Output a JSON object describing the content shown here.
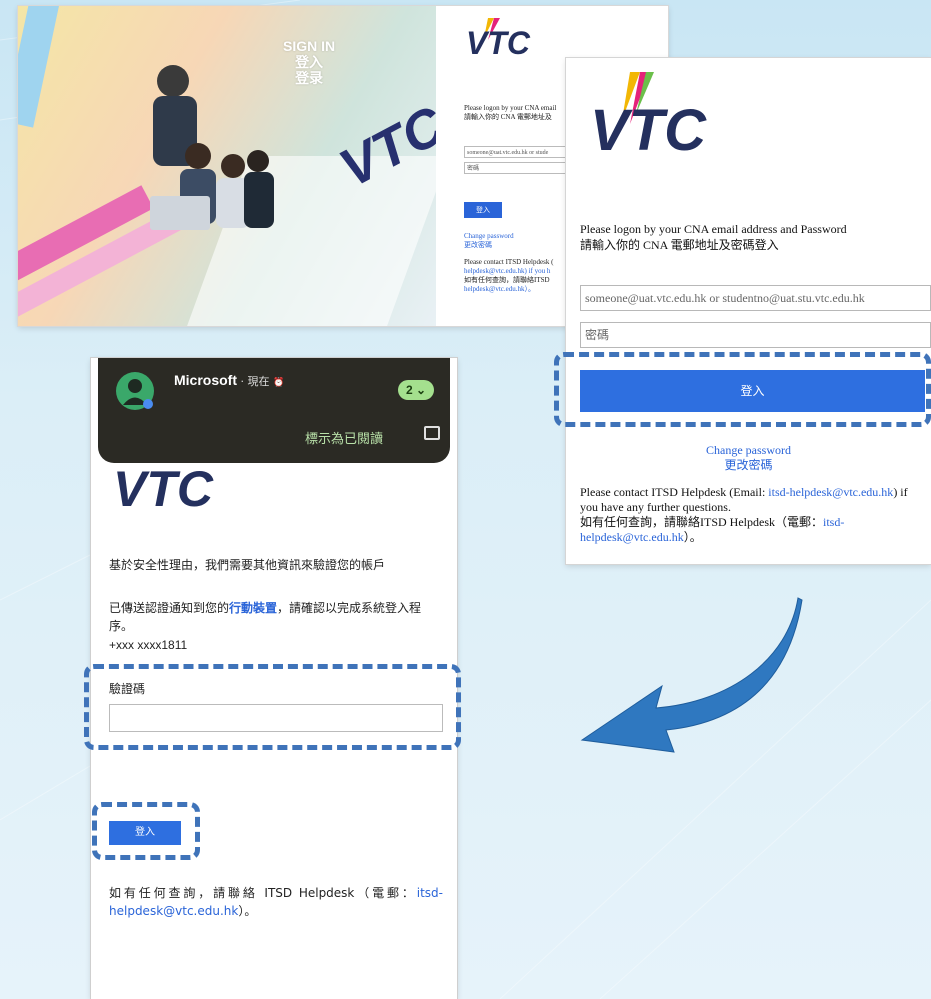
{
  "top_screenshot": {
    "signin_lines": [
      "SIGN IN",
      "登入",
      "登录"
    ],
    "instruction_en": "Please logon by your CNA email",
    "instruction_zh": "請輸入你的 CNA 電郵地址及",
    "email_placeholder": "someone@uat.vtc.edu.hk or stude",
    "password_placeholder": "密碼",
    "login_label": "登入",
    "change_password": "Change password",
    "change_password_zh": "更改密碼",
    "contact_line1": "Please contact ITSD Helpdesk (",
    "contact_line2": "helpdesk@vtc.edu.hk) if you h",
    "contact_line3": "如有任何查詢，請聯絡ITSD",
    "contact_line4": "helpdesk@vtc.edu.hk）。"
  },
  "right_panel": {
    "instruction_en": "Please logon by your CNA email address and Password",
    "instruction_zh": "請輸入你的 CNA 電郵地址及密碼登入",
    "email_placeholder": "someone@uat.vtc.edu.hk or studentno@uat.stu.vtc.edu.hk",
    "password_placeholder": "密碼",
    "login_label": "登入",
    "change_password": "Change password",
    "change_password_zh": "更改密碼",
    "contact_prefix": "Please contact ITSD Helpdesk (Email: ",
    "contact_email": "itsd-helpdesk@vtc.edu.hk",
    "contact_suffix": ") if you have any further questions.",
    "contact_zh_prefix": "如有任何查詢，請聯絡ITSD Helpdesk（電郵：",
    "contact_zh_email": "itsd-helpdesk@vtc.edu.hk",
    "contact_zh_suffix": "）。"
  },
  "phone": {
    "notification": {
      "app": "Microsoft",
      "time": " · 現在",
      "count": "2",
      "action": "標示為已閱讀"
    },
    "reason_text": "基於安全性理由，我們需要其他資訊來驗證您的帳戶",
    "sent_prefix": "已傳送認證通知到您的",
    "sent_link": "行動裝置",
    "sent_suffix": "，請確認以完成系統登入程序。",
    "phone_number": "+xxx xxxx1811",
    "code_label": "驗證碼",
    "login_label": "登入",
    "contact_prefix": "如有任何查詢，請聯絡 ITSD Helpdesk（電郵：",
    "contact_email": "itsd-helpdesk@vtc.edu.hk",
    "contact_suffix": "）。"
  },
  "logo_text": "VTC",
  "colors": {
    "accent_blue": "#2e6fe0",
    "dash_blue": "#3f73b9",
    "arrow_blue": "#2f78c0",
    "link_blue": "#2a64d8"
  }
}
